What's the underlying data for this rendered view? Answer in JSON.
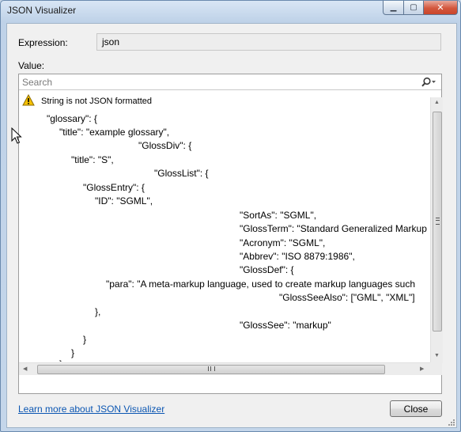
{
  "window": {
    "title": "JSON Visualizer",
    "controls": {
      "minimize": "▁",
      "maximize": "▢",
      "close": "✕"
    }
  },
  "expression": {
    "label": "Expression:",
    "value": "json"
  },
  "value_label": "Value:",
  "search": {
    "placeholder": "Search",
    "icon": "search-icon"
  },
  "warning": {
    "icon": "warning-icon",
    "text": "String is not JSON formatted"
  },
  "code_lines": [
    "\"glossary\": {",
    "\"title\": \"example glossary\",",
    "\"GlossDiv\": {",
    "\"title\": \"S\",",
    "\"GlossList\": {",
    "\"GlossEntry\": {",
    "\"ID\": \"SGML\",",
    "\"SortAs\": \"SGML\",",
    "\"GlossTerm\": \"Standard Generalized Markup",
    "\"Acronym\": \"SGML\",",
    "\"Abbrev\": \"ISO 8879:1986\",",
    "\"GlossDef\": {",
    "\"para\": \"A meta-markup language, used to create markup languages such",
    "\"GlossSeeAlso\": [\"GML\", \"XML\"]",
    "},",
    "\"GlossSee\": \"markup\"",
    "}",
    "}",
    "}"
  ],
  "footer": {
    "link": "Learn more about JSON Visualizer",
    "close_button": "Close"
  },
  "colors": {
    "link": "#0b56b2",
    "window_frame": "#c4d6ea",
    "warning": "#f5c000"
  }
}
